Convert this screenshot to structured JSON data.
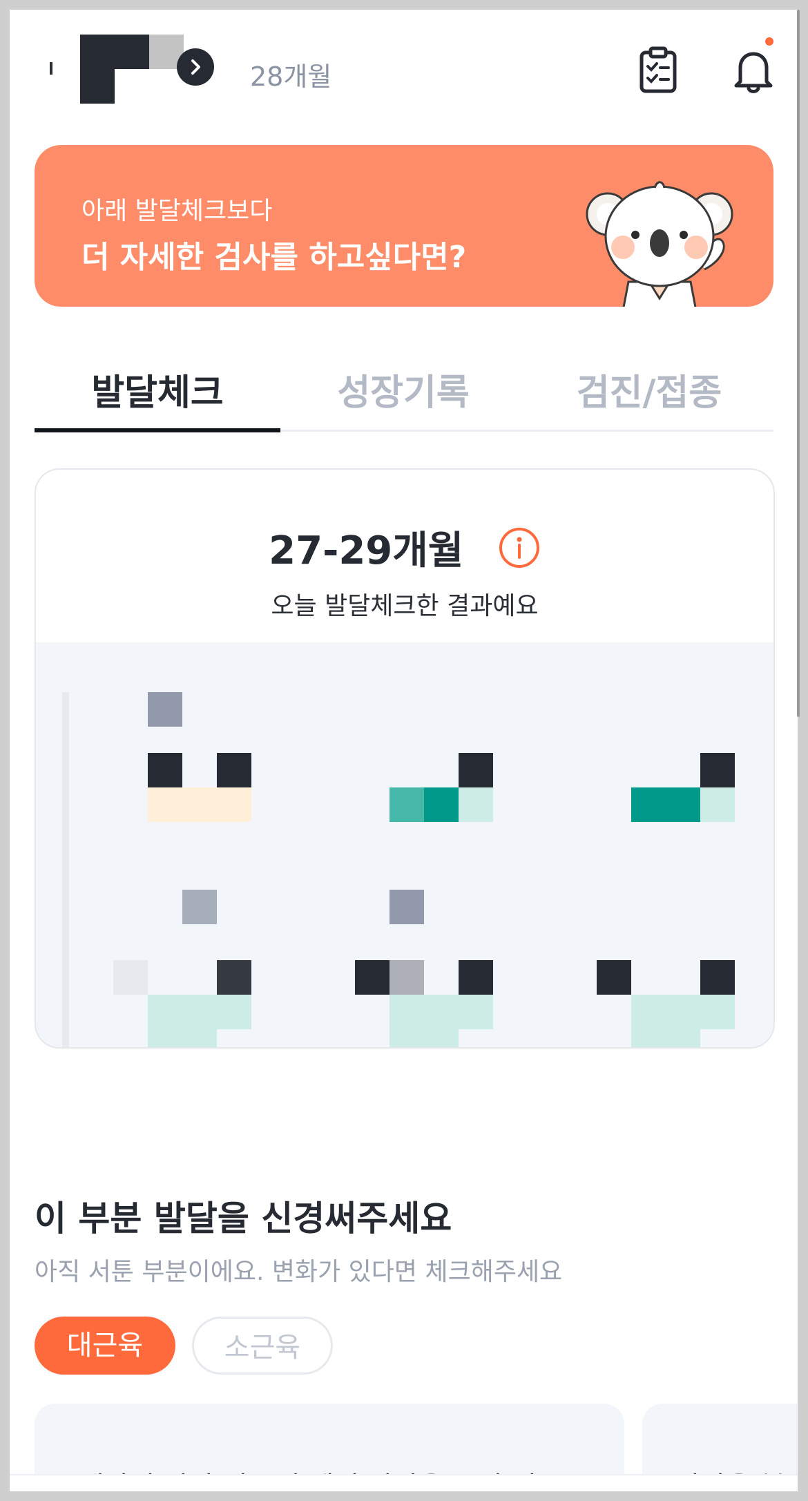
{
  "header": {
    "child_age": "28개월",
    "icons": [
      "arrow-right-icon",
      "clipboard-checklist-icon",
      "bell-icon"
    ],
    "accent_color": "#ff6a3d"
  },
  "banner": {
    "subtitle": "아래 발달체크보다",
    "title": "더 자세한 검사를 하고싶다면?",
    "background_color": "#ff8c68"
  },
  "tabs": [
    {
      "label": "발달체크",
      "active": true
    },
    {
      "label": "성장기록",
      "active": false
    },
    {
      "label": "검진/접종",
      "active": false
    }
  ],
  "result_card": {
    "title": "27-29개월",
    "subtitle": "오늘 발달체크한 결과예요"
  },
  "attention_section": {
    "title": "이 부분 발달을 신경써주세요",
    "description": "아직 서툰 부분이에요. 변화가 있다면 체크해주세요",
    "chips": [
      {
        "label": "대근육",
        "selected": true
      },
      {
        "label": "소근육",
        "selected": false
      }
    ],
    "questions": [
      {
        "text": "계단의 가장 낮은 층에서 양발을 모아 바"
      },
      {
        "text": "난간을 붙잡"
      }
    ]
  }
}
